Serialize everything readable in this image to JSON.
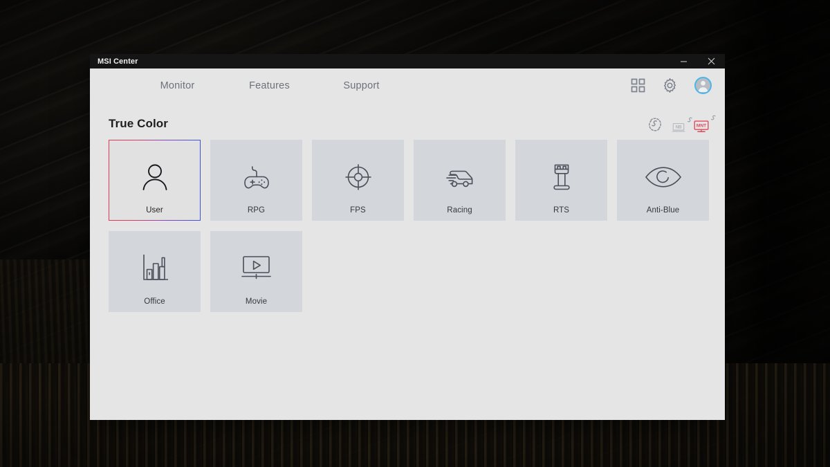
{
  "window": {
    "title": "MSI Center",
    "controls": [
      {
        "name": "minimize",
        "glyph": "minimize-icon"
      },
      {
        "name": "close",
        "glyph": "close-icon"
      }
    ]
  },
  "nav": {
    "items": [
      {
        "label": "Monitor",
        "key": "monitor",
        "active": false
      },
      {
        "label": "Features",
        "key": "features",
        "active": false
      },
      {
        "label": "Support",
        "key": "support",
        "active": false
      }
    ],
    "actions": [
      {
        "name": "apps-grid-icon"
      },
      {
        "name": "settings-gear-icon"
      },
      {
        "name": "user-avatar"
      }
    ]
  },
  "content": {
    "page_title": "True Color",
    "device_indicators": [
      {
        "name": "sync-devices-icon",
        "label": "",
        "type": "sync"
      },
      {
        "name": "notebook-device-chip",
        "label": "NB",
        "type": "laptop",
        "active": false
      },
      {
        "name": "monitor-device-chip",
        "label": "MNT",
        "type": "monitor",
        "active": true
      }
    ],
    "tiles": [
      {
        "label": "User",
        "icon": "user-icon",
        "selected": true
      },
      {
        "label": "RPG",
        "icon": "gamepad-icon",
        "selected": false
      },
      {
        "label": "FPS",
        "icon": "crosshair-icon",
        "selected": false
      },
      {
        "label": "Racing",
        "icon": "car-icon",
        "selected": false
      },
      {
        "label": "RTS",
        "icon": "chess-rook-icon",
        "selected": false
      },
      {
        "label": "Anti-Blue",
        "icon": "eye-icon",
        "selected": false
      },
      {
        "label": "Office",
        "icon": "bar-chart-icon",
        "selected": false
      },
      {
        "label": "Movie",
        "icon": "video-player-icon",
        "selected": false
      }
    ]
  },
  "colors": {
    "window_background": "#e5e5e5",
    "tile_background": "#d3d6da",
    "tile_selected_background": "#e1e1e1",
    "title_bar": "#151515",
    "selection_gradient_start": "#e8384f",
    "selection_gradient_end": "#3b53e0",
    "accent_blue": "#4cb6e8",
    "active_device_red": "#e0495c",
    "icon_stroke": "#4a4f59"
  }
}
